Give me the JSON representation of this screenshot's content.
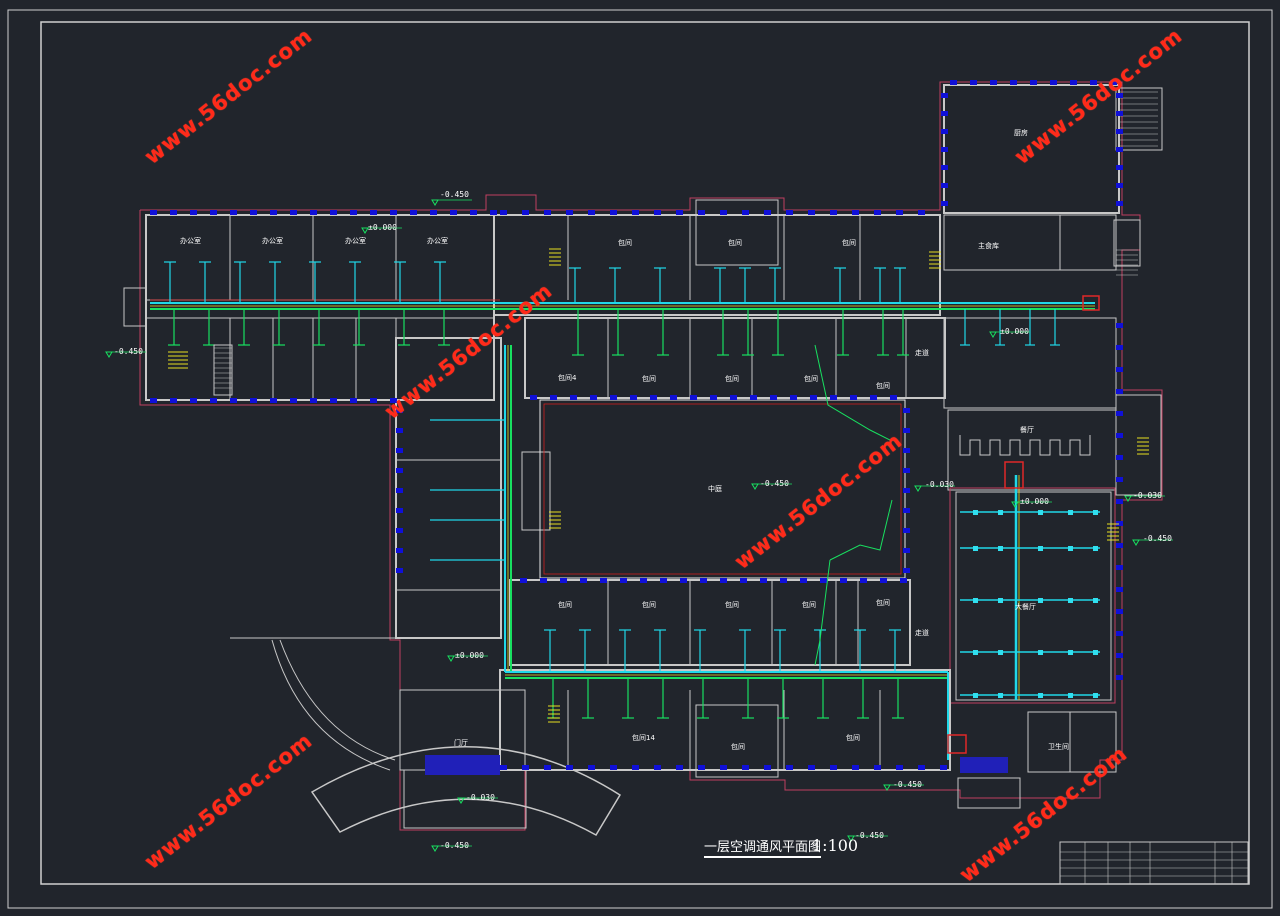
{
  "drawing": {
    "title": "一层空调通风平面图",
    "scale": "1:100"
  },
  "watermark": "www.56doc.com",
  "levels": [
    "-0.450",
    "±0.000",
    "-0.450",
    "±0.000",
    "-0.030",
    "-0.450",
    "±0.000",
    "-0.030",
    "-0.030",
    "-0.450",
    "-0.450",
    "-0.450",
    "±0.000",
    "-0.450"
  ],
  "rooms": [
    "办公室",
    "办公室",
    "办公室",
    "办公室",
    "包间",
    "包间",
    "包间",
    "主食库",
    "包间4",
    "包间",
    "包间",
    "包间",
    "中庭",
    "包间",
    "包间",
    "包间",
    "包间",
    "包间",
    "包间",
    "包间14",
    "包间",
    "包间",
    "门厅",
    "走道",
    "走道",
    "餐厅",
    "大餐厅",
    "卫生间",
    "厨房"
  ],
  "colors": {
    "background": "#21252c",
    "wall": "#c8c8c8",
    "column": "#1010d8",
    "duct_green": "#18e060",
    "duct_cyan": "#20d8e8",
    "duct_yellow": "#e8e020",
    "duct_red": "#e02828",
    "outline": "#c04060",
    "watermark": "#ff2a1a"
  }
}
